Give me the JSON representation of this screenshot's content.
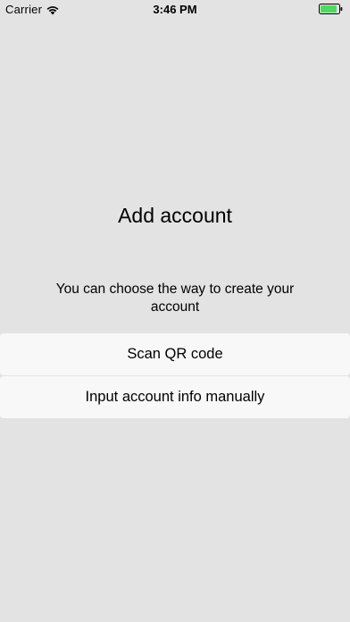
{
  "status_bar": {
    "carrier": "Carrier",
    "time": "3:46 PM",
    "icons": {
      "wifi": "wifi-icon",
      "battery": "battery-icon"
    },
    "battery_color": "#4cd964",
    "battery_level": 0.9
  },
  "main": {
    "title": "Add account",
    "subtitle": "You can choose the way to create your account",
    "buttons": [
      {
        "label": "Scan QR code"
      },
      {
        "label": "Input account info manually"
      }
    ]
  },
  "colors": {
    "background": "#e3e3e3",
    "button_background": "#f8f8f8"
  }
}
